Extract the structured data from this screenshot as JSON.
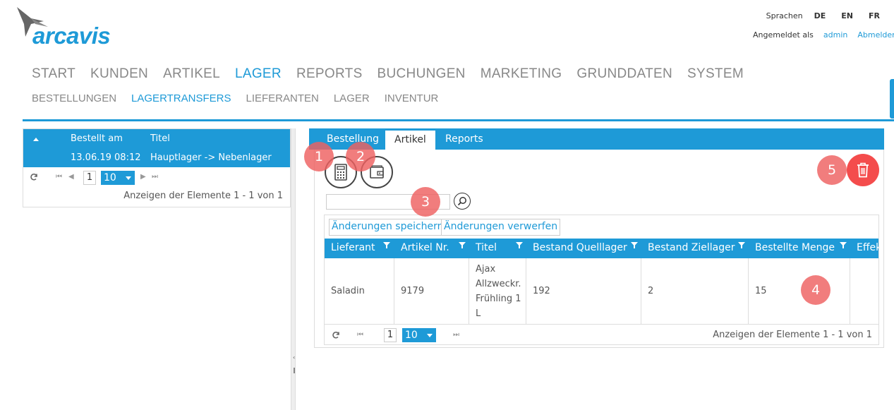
{
  "brand": {
    "logo_text": "arcavis",
    "color": "#1e9ad7"
  },
  "header": {
    "languages_label": "Sprachen",
    "languages": [
      "DE",
      "EN",
      "FR"
    ],
    "logged_in_label": "Angemeldet als",
    "user": "admin",
    "logout": "Abmelden"
  },
  "main_nav": [
    "START",
    "KUNDEN",
    "ARTIKEL",
    "LAGER",
    "REPORTS",
    "BUCHUNGEN",
    "MARKETING",
    "GRUNDDATEN",
    "SYSTEM"
  ],
  "main_nav_active": "LAGER",
  "sub_nav": [
    "BESTELLUNGEN",
    "LAGERTRANSFERS",
    "LIEFERANTEN",
    "LAGER",
    "INVENTUR"
  ],
  "sub_nav_active": "LAGERTRANSFERS",
  "left_grid": {
    "columns": [
      "Bestellt am",
      "Titel"
    ],
    "rows": [
      {
        "date": "13.06.19 08:12",
        "title": "Hauptlager -> Nebenlager"
      }
    ],
    "page": "1",
    "page_size": "10",
    "footer": "Anzeigen der Elemente 1 - 1 von 1"
  },
  "tabs": [
    "Bestellung",
    "Artikel",
    "Reports"
  ],
  "active_tab": "Artikel",
  "markers": [
    "1",
    "2",
    "3",
    "4",
    "5"
  ],
  "toolbar": {
    "save_label": "Änderungen speichern",
    "discard_label": "Änderungen verwerfen",
    "search_placeholder": ""
  },
  "article_grid": {
    "columns": [
      "Lieferant",
      "Artikel Nr.",
      "Titel",
      "Bestand Quelllager",
      "Bestand Ziellager",
      "Bestellte Menge",
      "Effektive"
    ],
    "rows": [
      {
        "supplier": "Saladin",
        "article_no": "9179",
        "title_lines": [
          "Ajax",
          "Allzweckr.",
          "Frühling 1",
          "L"
        ],
        "stock_source": "192",
        "stock_target": "2",
        "ordered": "15",
        "effective": ""
      }
    ],
    "page": "1",
    "page_size": "10",
    "footer": "Anzeigen der Elemente 1 - 1 von 1"
  },
  "icons": [
    "calculator-icon",
    "wallet-icon",
    "search-icon",
    "trash-icon",
    "refresh-icon",
    "filter-icon"
  ]
}
